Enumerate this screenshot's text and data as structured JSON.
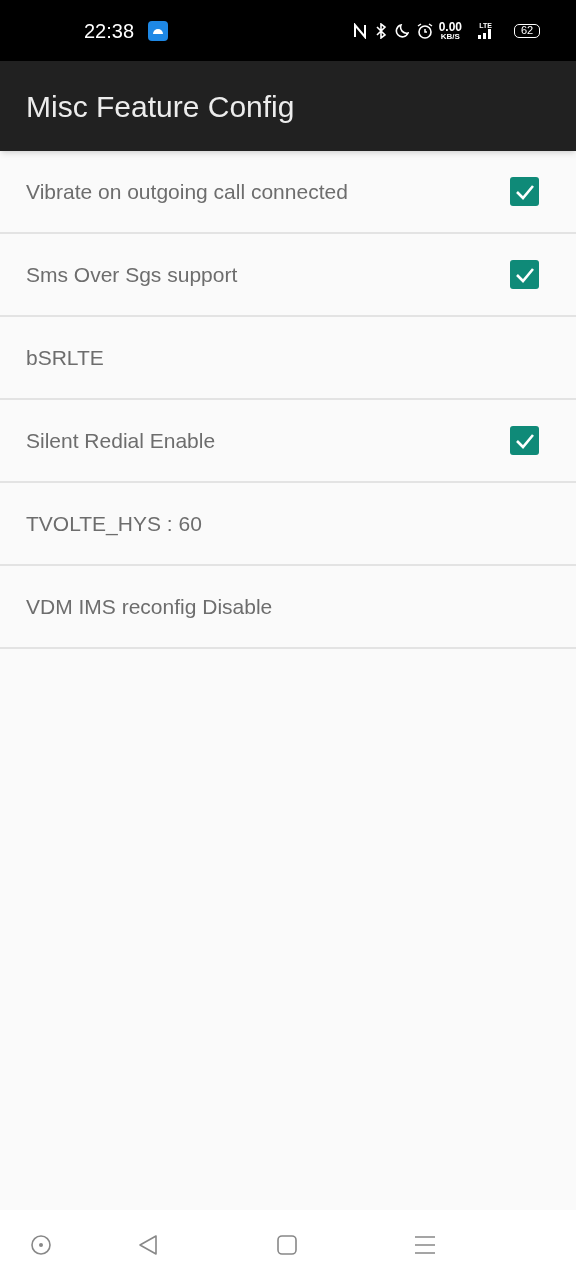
{
  "status_bar": {
    "time": "22:38",
    "speed_value": "0.00",
    "speed_unit": "KB/S",
    "network": "LTE",
    "battery": "62"
  },
  "app_bar": {
    "title": "Misc Feature Config"
  },
  "items": [
    {
      "kind": "checkbox",
      "label": "Vibrate on outgoing call connected",
      "checked": true
    },
    {
      "kind": "checkbox",
      "label": "Sms Over Sgs support",
      "checked": true
    },
    {
      "kind": "text",
      "label": "bSRLTE"
    },
    {
      "kind": "checkbox",
      "label": "Silent Redial Enable",
      "checked": true
    },
    {
      "kind": "text",
      "label": "TVOLTE_HYS : 60"
    },
    {
      "kind": "text",
      "label": "VDM IMS reconfig Disable"
    }
  ]
}
